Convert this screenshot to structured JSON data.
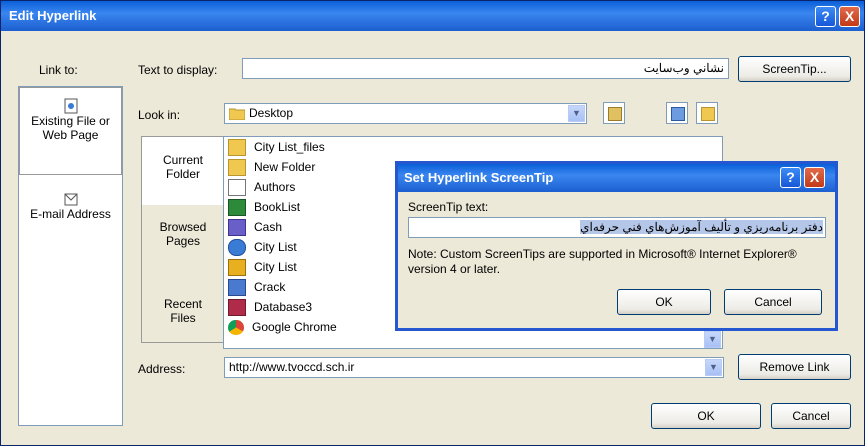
{
  "dialog": {
    "title": "Edit Hyperlink",
    "help_btn": "?",
    "close_btn": "X",
    "link_to_label": "Link to:",
    "text_to_display_label": "Text to display:",
    "text_to_display_value": "نشاني وب‌سايت",
    "screentip_btn": "ScreenTip...",
    "look_in_label": "Look in:",
    "look_in_value": "Desktop",
    "link_to_items": [
      {
        "label_line1": "Existing File or",
        "label_line2": "Web Page"
      },
      {
        "label_line1": "E-mail Address",
        "label_line2": ""
      }
    ],
    "tabs": [
      {
        "line1": "Current",
        "line2": "Folder"
      },
      {
        "line1": "Browsed",
        "line2": "Pages"
      },
      {
        "line1": "Recent",
        "line2": "Files"
      }
    ],
    "files": [
      "City List_files",
      "New Folder",
      "Authors",
      "BookList",
      "Cash",
      "City List",
      "City List",
      "Crack",
      "Database3",
      "Google Chrome"
    ],
    "address_label": "Address:",
    "address_value": "http://www.tvoccd.sch.ir",
    "remove_link_btn": "Remove Link",
    "ok_btn": "OK",
    "cancel_btn": "Cancel"
  },
  "screentip_dialog": {
    "title": "Set Hyperlink ScreenTip",
    "help_btn": "?",
    "close_btn": "X",
    "text_label": "ScreenTip text:",
    "text_value": "دفتر برنامه‌ريزي و تأليف آموزش‌هاي فني حرفه‌اي",
    "note": "Note: Custom ScreenTips are supported in Microsoft® Internet Explorer® version 4 or later.",
    "ok_btn": "OK",
    "cancel_btn": "Cancel"
  },
  "colors": {
    "titlebar": "#1c5fd0",
    "close": "#c23a18",
    "selection": "#b5c7e8"
  }
}
